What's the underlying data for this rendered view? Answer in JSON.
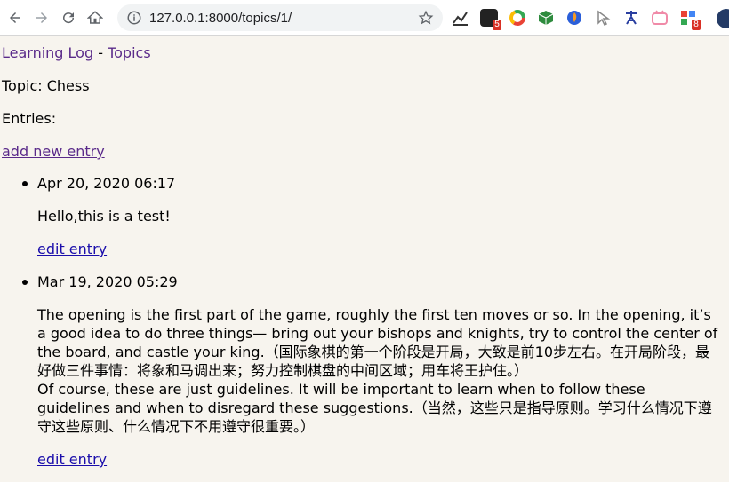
{
  "browser": {
    "url": "127.0.0.1:8000/topics/1/",
    "extensions": [
      {
        "icon": "bar-chart-extension-icon",
        "badge": ""
      },
      {
        "icon": "black-square-extension-icon",
        "badge": "5"
      },
      {
        "icon": "color-ring-extension-icon",
        "badge": ""
      },
      {
        "icon": "green-cube-extension-icon",
        "badge": ""
      },
      {
        "icon": "blue-circle-extension-icon",
        "badge": ""
      },
      {
        "icon": "cursor-extension-icon",
        "badge": ""
      },
      {
        "icon": "translate-extension-icon",
        "badge": ""
      },
      {
        "icon": "pink-tv-extension-icon",
        "badge": ""
      },
      {
        "icon": "grid-extension-icon",
        "badge": "8"
      }
    ]
  },
  "nav": {
    "home_link": "Learning Log",
    "separator": " - ",
    "topics_link": "Topics"
  },
  "topic_heading": "Topic: Chess",
  "entries_label": "Entries:",
  "add_entry_link": "add new entry",
  "entries": [
    {
      "date": "Apr 20, 2020 06:17",
      "text": "Hello,this is a test!",
      "edit_label": "edit entry"
    },
    {
      "date": "Mar 19, 2020 05:29",
      "text": "The opening is the first part of the game, roughly the first ten moves or so. In the opening, it’s a good idea to do three things— bring out your bishops and knights, try to control the center of the board, and castle your king.（国际象棋的第一个阶段是开局，大致是前10步左右。在开局阶段，最好做三件事情：将象和马调出来；努力控制棋盘的中间区域；用车将王护住。）\nOf course, these are just guidelines. It will be important to learn when to follow these guidelines and when to disregard these suggestions.（当然，这些只是指导原则。学习什么情况下遵守这些原则、什么情况下不用遵守很重要。）",
      "edit_label": "edit entry"
    }
  ]
}
